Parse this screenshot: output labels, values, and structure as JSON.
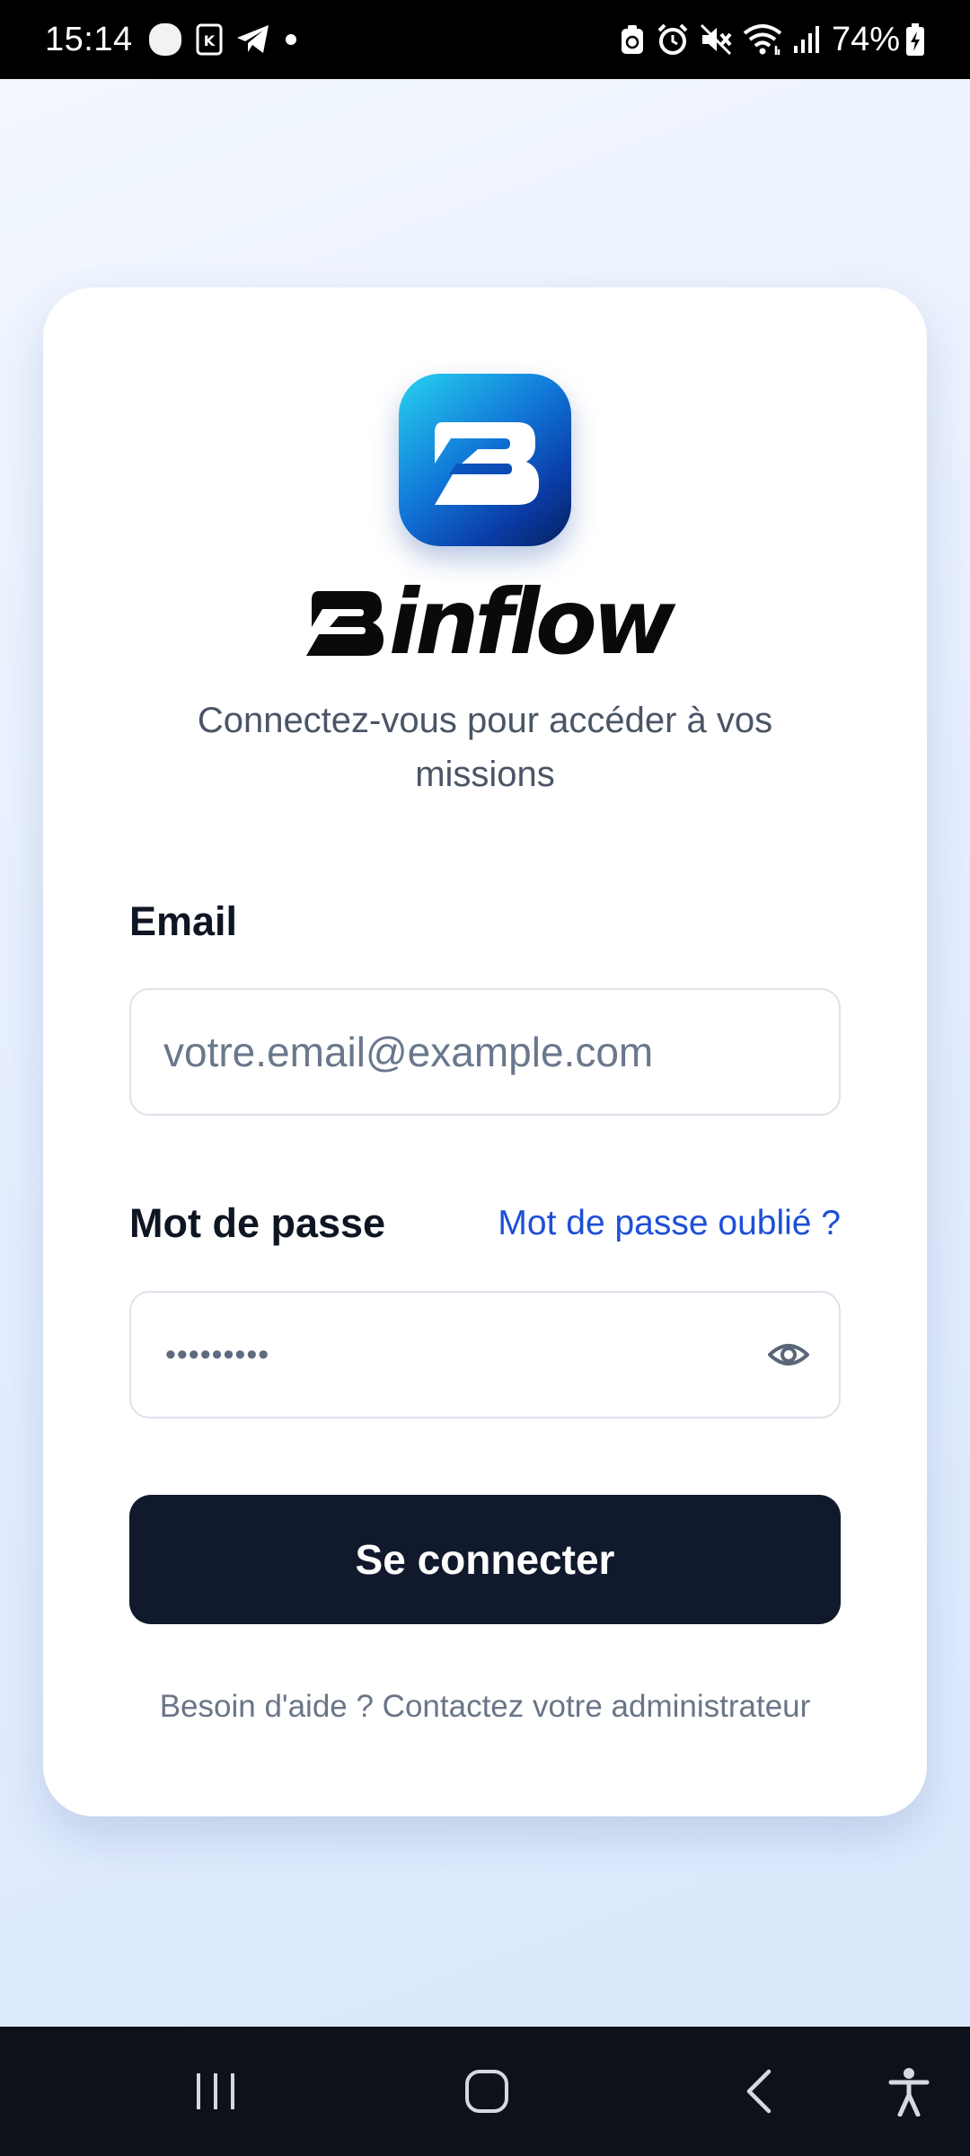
{
  "status_bar": {
    "time": "15:14",
    "battery_percent": "74%",
    "left_icons": [
      "circle-notification-icon",
      "k-app-icon",
      "telegram-icon",
      "dot-icon"
    ],
    "right_icons": [
      "data-saver-icon",
      "alarm-icon",
      "mute-icon",
      "wifi-icon",
      "signal-icon",
      "battery-charging-icon"
    ]
  },
  "app": {
    "name": "Binflow",
    "wordmark_rest": "inflow",
    "subtitle": "Connectez-vous pour accéder à vos missions",
    "logo_icon": "binflow-logo-icon",
    "logo_gradient": [
      "#27d3ef",
      "#1177d8",
      "#0a3da8",
      "#06205e"
    ]
  },
  "form": {
    "email_label": "Email",
    "email_placeholder": "votre.email@example.com",
    "email_value": "",
    "password_label": "Mot de passe",
    "forgot_password": "Mot de passe oublié ?",
    "password_masked": "•••••••••",
    "toggle_visibility_icon": "eye-icon",
    "submit_label": "Se connecter",
    "help_text": "Besoin d'aide ? Contactez votre administrateur"
  },
  "nav_bar": {
    "buttons": [
      "recents-icon",
      "home-icon",
      "back-icon",
      "accessibility-icon"
    ]
  },
  "colors": {
    "primary_button": "#111a2c",
    "link": "#1d4fd8",
    "text_primary": "#0f1623",
    "text_secondary": "#4a5566",
    "status_bar_bg": "#000000",
    "nav_bar_bg": "#0d121a"
  }
}
